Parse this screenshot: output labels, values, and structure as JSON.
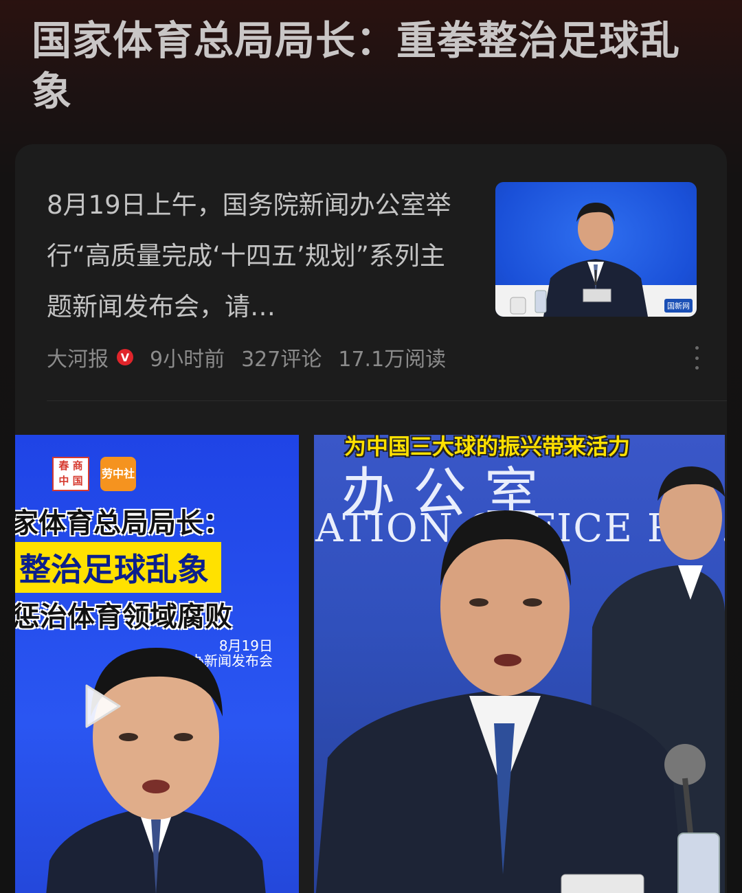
{
  "headline": "国家体育总局局长：重拳整治足球乱象",
  "article": {
    "summary": "8月19日上午，国务院新闻办公室举行“高质量完成‘十四五’规划”系列主题新闻发布会，请…",
    "source": "大河报",
    "verified_badge": "V",
    "time": "9小时前",
    "comments": "327评论",
    "reads": "17.1万阅读",
    "thumbnail_watermark": "国新网"
  },
  "video_left": {
    "logo_a": "春 商 中 国",
    "logo_b": "劳中社",
    "line1": "家体育总局局长：",
    "line2": "整治足球乱象",
    "line3": "惩治体育领域腐败",
    "date": "8月19日",
    "event": "国新办新闻发布会"
  },
  "video_right": {
    "caption": "为中国三大球的振兴带来活力",
    "wall_text_cn": "办公室",
    "wall_text_en": "ATION OFFICE  R.C."
  },
  "colors": {
    "accent_red": "#e0252b",
    "caption_yellow": "#ffe100",
    "stage_blue": "#1f44e6"
  }
}
